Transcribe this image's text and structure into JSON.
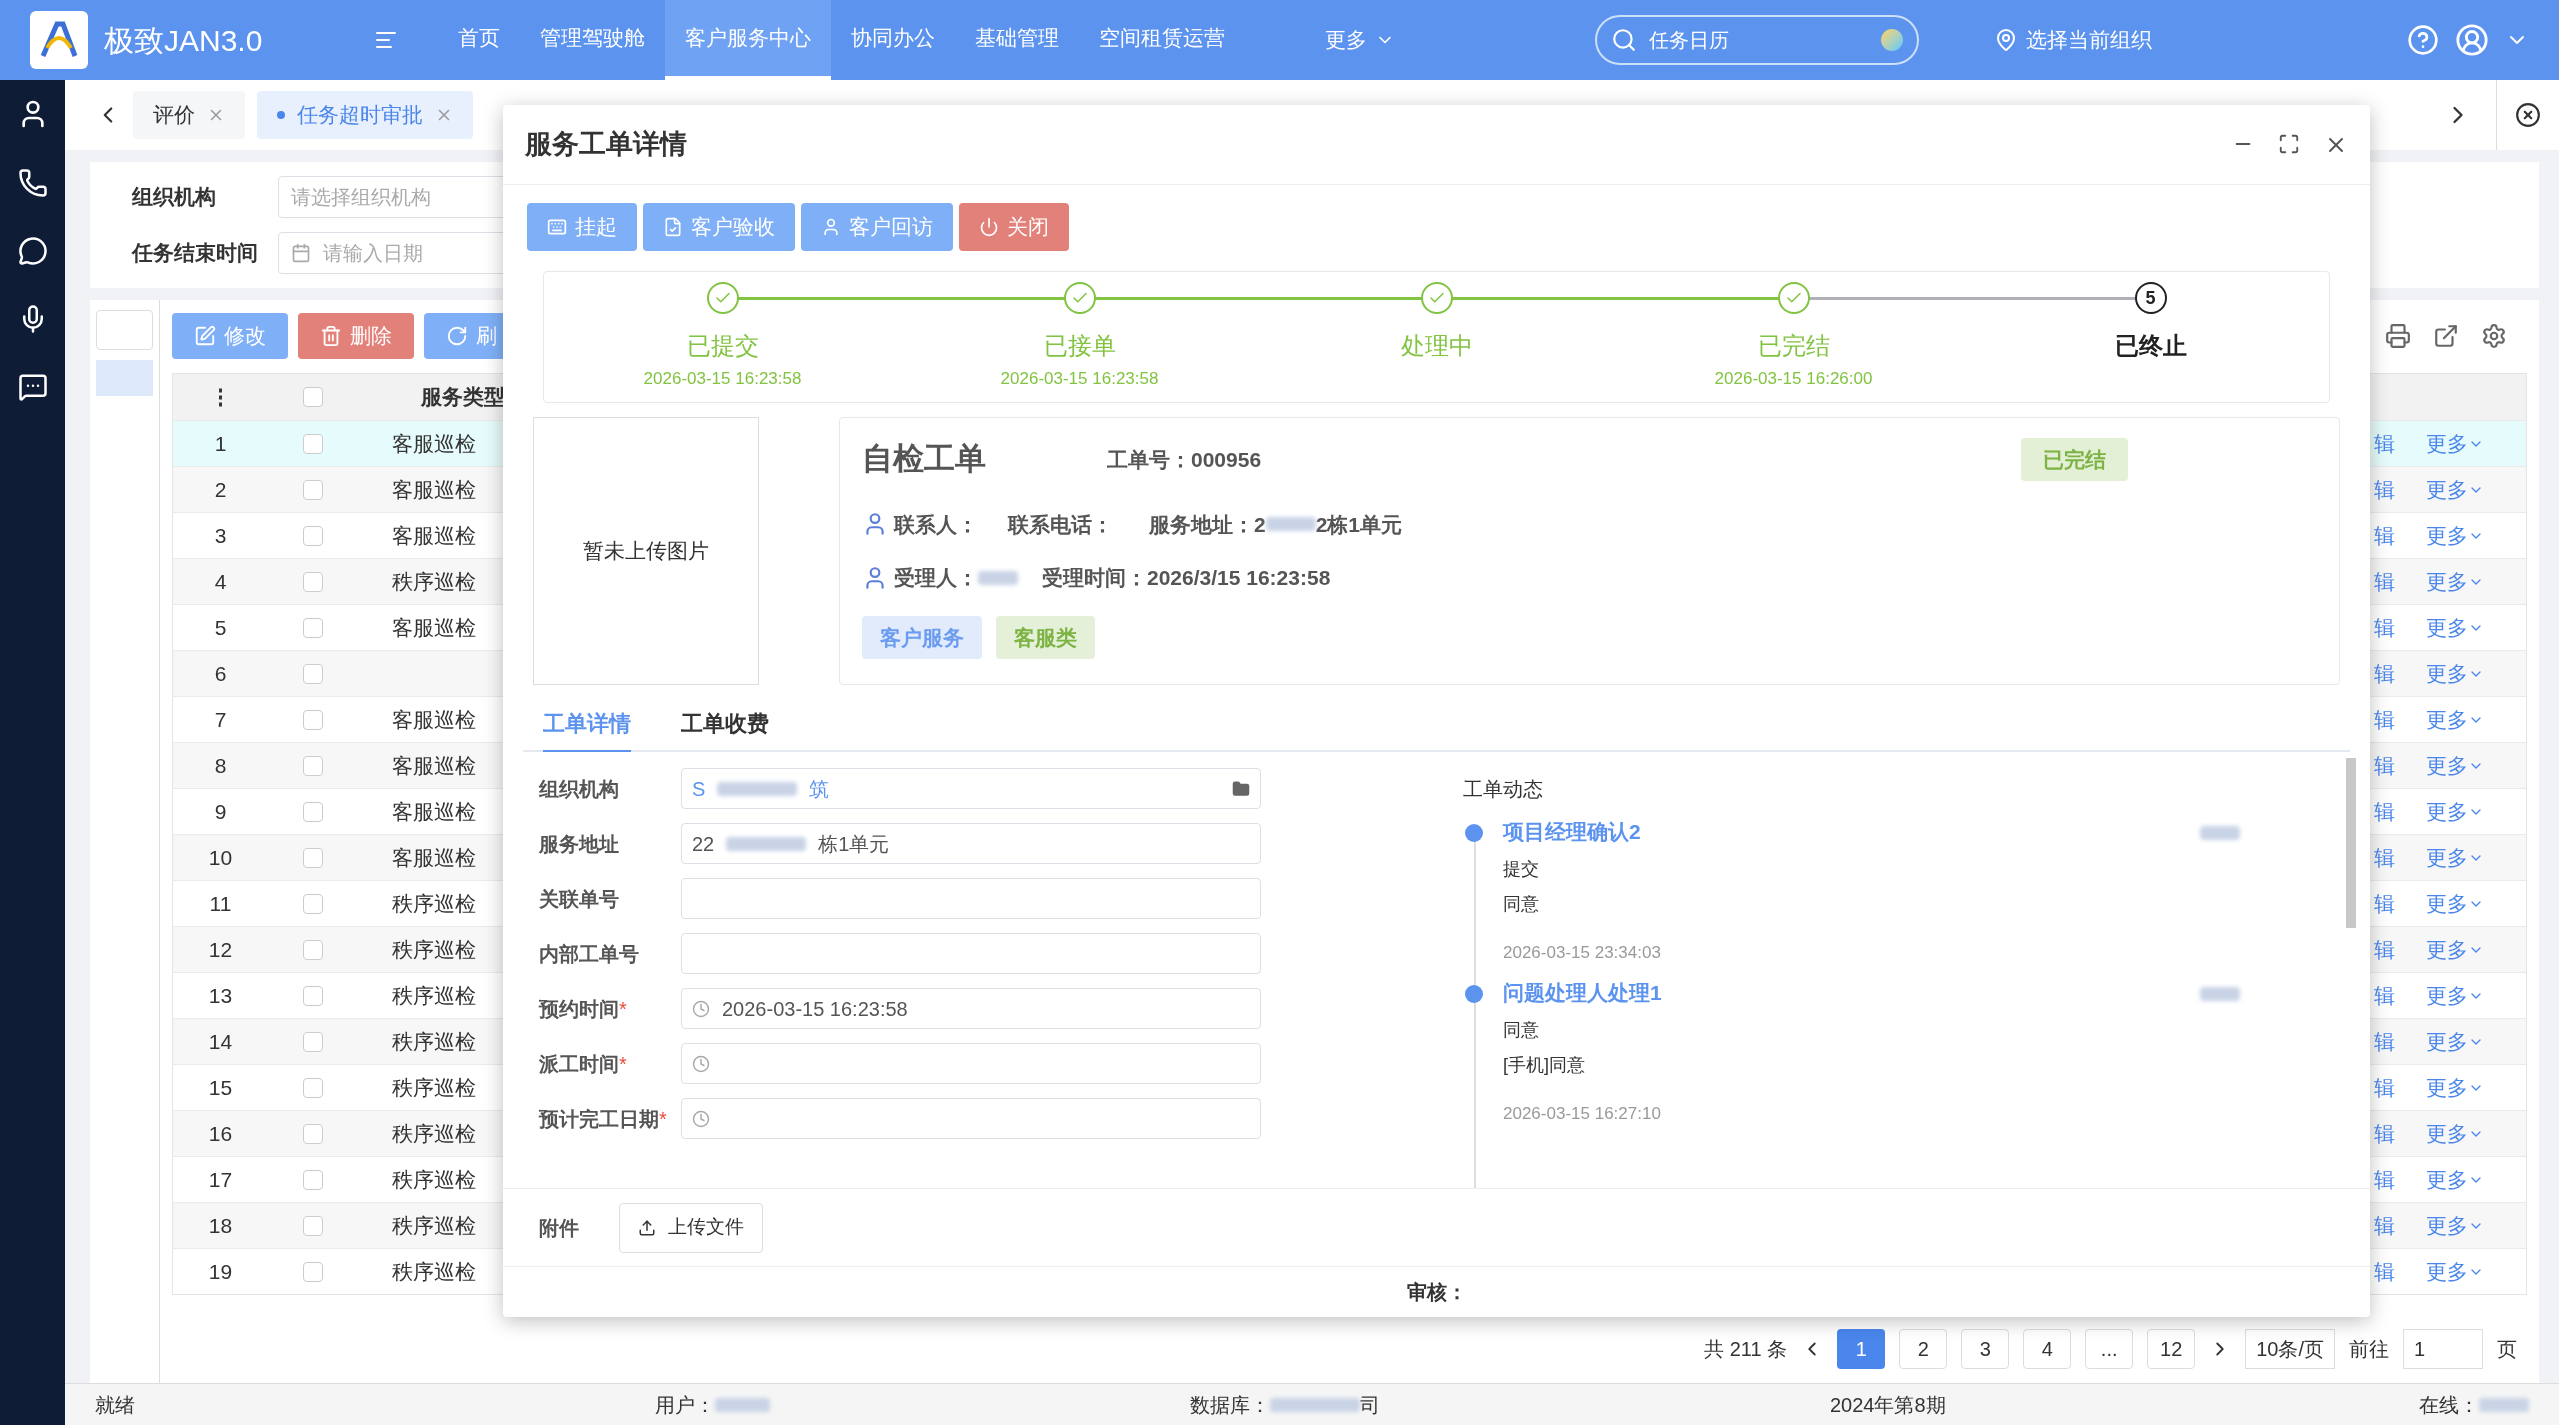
{
  "app": {
    "title": "极致JAN3.0"
  },
  "nav": [
    {
      "label": "首页",
      "selected": false
    },
    {
      "label": "管理驾驶舱",
      "selected": false
    },
    {
      "label": "客户服务中心",
      "selected": true
    },
    {
      "label": "协同办公",
      "selected": false
    },
    {
      "label": "基础管理",
      "selected": false
    },
    {
      "label": "空间租赁运营",
      "selected": false
    }
  ],
  "nav_more": "更多",
  "search": {
    "value": "任务日历"
  },
  "org_picker": "选择当前组织",
  "tabs": [
    {
      "label": "评价",
      "selected": false
    },
    {
      "label": "任务超时审批",
      "selected": true
    }
  ],
  "filters": [
    {
      "label": "组织机构",
      "placeholder": "请选择组织机构",
      "kind": "select"
    },
    {
      "label": "任务结束时间",
      "placeholder": "请输入日期",
      "kind": "date"
    }
  ],
  "toolbar": [
    {
      "label": "修改",
      "kind": "edit"
    },
    {
      "label": "删除",
      "kind": "delete"
    },
    {
      "label": "刷",
      "kind": "refresh"
    }
  ],
  "table": {
    "menu_glyph": "⋮",
    "select_all": {
      "checked": false
    },
    "columns": [
      "服务类型"
    ],
    "rows": [
      {
        "index": "1",
        "type": "客服巡检",
        "selected": true,
        "checked": false,
        "edit": "辑",
        "more": "更多"
      },
      {
        "index": "2",
        "type": "客服巡检",
        "selected": false,
        "checked": false,
        "edit": "辑",
        "more": "更多"
      },
      {
        "index": "3",
        "type": "客服巡检",
        "selected": false,
        "checked": false,
        "edit": "辑",
        "more": "更多"
      },
      {
        "index": "4",
        "type": "秩序巡检",
        "selected": false,
        "checked": false,
        "edit": "辑",
        "more": "更多"
      },
      {
        "index": "5",
        "type": "客服巡检",
        "selected": false,
        "checked": false,
        "edit": "辑",
        "more": "更多"
      },
      {
        "index": "6",
        "selected": false,
        "checked": false,
        "edit": "辑",
        "more": "更多"
      },
      {
        "index": "7",
        "type": "客服巡检",
        "selected": false,
        "checked": false,
        "edit": "辑",
        "more": "更多"
      },
      {
        "index": "8",
        "type": "客服巡检",
        "selected": false,
        "checked": false,
        "edit": "辑",
        "more": "更多"
      },
      {
        "index": "9",
        "type": "客服巡检",
        "selected": false,
        "checked": false,
        "edit": "辑",
        "more": "更多"
      },
      {
        "index": "10",
        "type": "客服巡检",
        "selected": false,
        "checked": false,
        "edit": "辑",
        "more": "更多"
      },
      {
        "index": "11",
        "type": "秩序巡检",
        "selected": false,
        "checked": false,
        "edit": "辑",
        "more": "更多"
      },
      {
        "index": "12",
        "type": "秩序巡检",
        "selected": false,
        "checked": false,
        "edit": "辑",
        "more": "更多"
      },
      {
        "index": "13",
        "type": "秩序巡检",
        "selected": false,
        "checked": false,
        "edit": "辑",
        "more": "更多"
      },
      {
        "index": "14",
        "type": "秩序巡检",
        "selected": false,
        "checked": false,
        "edit": "辑",
        "more": "更多"
      },
      {
        "index": "15",
        "type": "秩序巡检",
        "selected": false,
        "checked": false,
        "edit": "辑",
        "more": "更多"
      },
      {
        "index": "16",
        "type": "秩序巡检",
        "selected": false,
        "checked": false,
        "edit": "辑",
        "more": "更多"
      },
      {
        "index": "17",
        "type": "秩序巡检",
        "selected": false,
        "checked": false,
        "edit": "辑",
        "more": "更多"
      },
      {
        "index": "18",
        "type": "秩序巡检",
        "selected": false,
        "checked": false,
        "edit": "辑",
        "more": "更多"
      },
      {
        "index": "19",
        "type": "秩序巡检",
        "selected": false,
        "checked": false,
        "edit": "辑",
        "more": "更多"
      }
    ]
  },
  "pagination": {
    "total": "共 211 条",
    "pages": [
      {
        "label": "1",
        "selected": true
      },
      {
        "label": "2",
        "selected": false
      },
      {
        "label": "3",
        "selected": false
      },
      {
        "label": "4",
        "selected": false
      },
      {
        "label": "...",
        "selected": false
      },
      {
        "label": "12",
        "selected": false
      }
    ],
    "page_size": "10条/页",
    "goto": "前往",
    "goto_value": "1",
    "unit": "页"
  },
  "modal": {
    "title": "服务工单详情",
    "actions": [
      {
        "label": "挂起",
        "kind": "suspend"
      },
      {
        "label": "客户验收",
        "kind": "accept"
      },
      {
        "label": "客户回访",
        "kind": "visit"
      },
      {
        "label": "关闭",
        "kind": "close"
      }
    ],
    "steps": [
      {
        "label": "已提交",
        "time": "2026-03-15 16:23:58",
        "completed": true
      },
      {
        "label": "已接单",
        "time": "2026-03-15 16:23:58",
        "completed": true
      },
      {
        "label": "处理中",
        "completed": true
      },
      {
        "label": "已完结",
        "time": "2026-03-15 16:26:00",
        "completed": true
      },
      {
        "label": "已终止",
        "number": "5",
        "completed": false
      }
    ],
    "required_mark": "*",
    "image_placeholder": "暂未上传图片",
    "order": {
      "title": "自检工单",
      "number": "工单号：000956",
      "status": "已完结",
      "contact": "联系人：",
      "phone": "联系电话：",
      "address_start": "服务地址：2",
      "address_end": "2栋1单元",
      "handler": "受理人：",
      "handle_time": "受理时间：2026/3/15 16:23:58",
      "tags": [
        {
          "label": "客户服务",
          "color": "#6b9cf0"
        },
        {
          "label": "客服类",
          "color": "#7cb342"
        }
      ]
    },
    "detail_tabs": [
      {
        "label": "工单详情",
        "selected": true
      },
      {
        "label": "工单收费",
        "selected": false
      }
    ],
    "fields": [
      {
        "label": "组织机构",
        "required": false,
        "kind": "org",
        "value_start": "S",
        "value_end": "筑"
      },
      {
        "label": "服务地址",
        "required": false,
        "kind": "text",
        "value_start": "22",
        "value_end": "栋1单元"
      },
      {
        "label": "关联单号",
        "required": false,
        "kind": "text"
      },
      {
        "label": "内部工单号",
        "required": false,
        "kind": "text"
      },
      {
        "label": "预约时间",
        "required": true,
        "kind": "time",
        "value_start": "2026-03-15 16:23:58"
      },
      {
        "label": "派工时间",
        "required": true,
        "kind": "time"
      },
      {
        "label": "预计完工日期",
        "required": true,
        "kind": "time"
      }
    ],
    "timeline": {
      "title": "工单动态",
      "entries": [
        {
          "title": "项目经理确认2",
          "lines": [
            "提交",
            "同意"
          ],
          "time": "2026-03-15 23:34:03"
        },
        {
          "title": "问题处理人处理1",
          "lines": [
            "同意",
            "[手机]同意"
          ],
          "time": "2026-03-15 16:27:10"
        }
      ]
    },
    "attachment": {
      "label": "附件",
      "button": "上传文件"
    },
    "review": "审核："
  },
  "status_bar": {
    "state": "就绪",
    "user": "用户：",
    "database_start": "数据库：",
    "database_end": "司",
    "period": "2024年第8期",
    "online": "在线："
  }
}
